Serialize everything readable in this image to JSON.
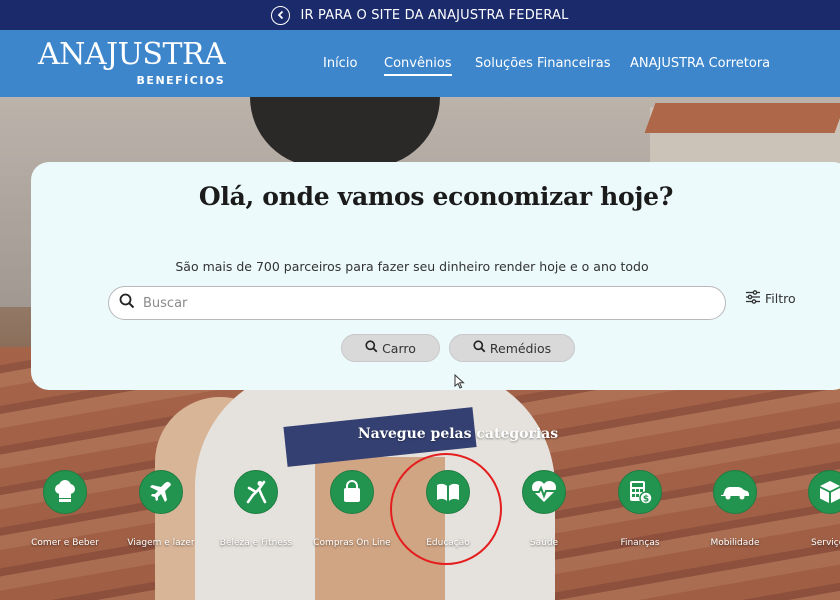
{
  "topbar": {
    "label": "IR PARA O SITE DA ANAJUSTRA FEDERAL"
  },
  "logo": {
    "main": "ANAJUSTRA",
    "sub": "BENEFÍCIOS"
  },
  "nav": [
    {
      "label": "Início",
      "active": false
    },
    {
      "label": "Convênios",
      "active": true
    },
    {
      "label": "Soluções Financeiras",
      "active": false
    },
    {
      "label": "ANAJUSTRA Corretora",
      "active": false
    }
  ],
  "hero": {
    "title": "Olá, onde vamos economizar hoje?",
    "tagline": "São mais de 700 parceiros para fazer seu dinheiro render hoje e o ano todo",
    "search_placeholder": "Buscar",
    "filter_label": "Filtro",
    "quick_searches": [
      "Carro",
      "Remédios"
    ]
  },
  "categories": {
    "title": "Navegue pelas categorias",
    "items": [
      {
        "label": "Comer e Beber",
        "icon": "chef-hat-icon"
      },
      {
        "label": "Viagem e lazer",
        "icon": "airplane-icon"
      },
      {
        "label": "Beleza e Fitness",
        "icon": "stretching-person-icon"
      },
      {
        "label": "Compras On Line",
        "icon": "shopping-bag-icon"
      },
      {
        "label": "Educação",
        "icon": "open-book-icon"
      },
      {
        "label": "Saúde",
        "icon": "heart-pulse-icon"
      },
      {
        "label": "Finanças",
        "icon": "calculator-coin-icon"
      },
      {
        "label": "Mobilidade",
        "icon": "car-icon"
      },
      {
        "label": "Serviços",
        "icon": "box-icon"
      }
    ]
  },
  "colors": {
    "topbar": "#1b2a6b",
    "header": "#3d86cc",
    "category": "#23944f",
    "highlight": "#e41e1e",
    "card": "#ecfafb"
  }
}
